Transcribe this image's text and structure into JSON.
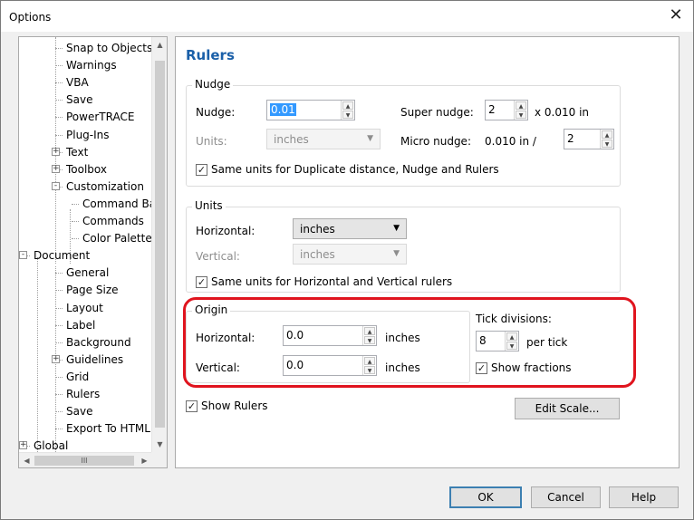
{
  "window": {
    "title": "Options",
    "close_glyph": "✕"
  },
  "tree": {
    "items": [
      {
        "label": "Snap to Objects",
        "level": 2
      },
      {
        "label": "Warnings",
        "level": 2
      },
      {
        "label": "VBA",
        "level": 2
      },
      {
        "label": "Save",
        "level": 2
      },
      {
        "label": "PowerTRACE",
        "level": 2
      },
      {
        "label": "Plug-Ins",
        "level": 2
      },
      {
        "label": "Text",
        "level": 2,
        "expander": "+"
      },
      {
        "label": "Toolbox",
        "level": 2,
        "expander": "+"
      },
      {
        "label": "Customization",
        "level": 2,
        "expander": "-"
      },
      {
        "label": "Command Ba",
        "level": 3
      },
      {
        "label": "Commands",
        "level": 3
      },
      {
        "label": "Color Palette",
        "level": 3
      },
      {
        "label": "Document",
        "level": 1,
        "expander": "-"
      },
      {
        "label": "General",
        "level": 2
      },
      {
        "label": "Page Size",
        "level": 2
      },
      {
        "label": "Layout",
        "level": 2
      },
      {
        "label": "Label",
        "level": 2
      },
      {
        "label": "Background",
        "level": 2
      },
      {
        "label": "Guidelines",
        "level": 2,
        "expander": "+"
      },
      {
        "label": "Grid",
        "level": 2
      },
      {
        "label": "Rulers",
        "level": 2,
        "selected": true
      },
      {
        "label": "Save",
        "level": 2
      },
      {
        "label": "Export To HTML",
        "level": 2
      },
      {
        "label": "Global",
        "level": 1,
        "expander": "+"
      }
    ],
    "hscroll_glyph": "III"
  },
  "panel": {
    "title": "Rulers",
    "nudge": {
      "group_title": "Nudge",
      "nudge_label": "Nudge:",
      "nudge_value": "0.01",
      "super_nudge_label": "Super nudge:",
      "super_nudge_value": "2",
      "super_nudge_suffix": "x 0.010 in",
      "units_label": "Units:",
      "units_value": "inches",
      "micro_nudge_label": "Micro nudge:",
      "micro_nudge_prefix": "0.010 in /",
      "micro_nudge_value": "2",
      "same_units_label": "Same units for Duplicate distance, Nudge and Rulers",
      "same_units_checked": true
    },
    "units": {
      "group_title": "Units",
      "horizontal_label": "Horizontal:",
      "horizontal_value": "inches",
      "vertical_label": "Vertical:",
      "vertical_value": "inches",
      "same_units_label": "Same units for Horizontal and Vertical rulers",
      "same_units_checked": true
    },
    "origin": {
      "group_title": "Origin",
      "horizontal_label": "Horizontal:",
      "horizontal_value": "0.0",
      "horizontal_unit": "inches",
      "vertical_label": "Vertical:",
      "vertical_value": "0.0",
      "vertical_unit": "inches"
    },
    "tick": {
      "title": "Tick divisions:",
      "value": "8",
      "suffix": "per tick",
      "show_fractions_label": "Show fractions",
      "show_fractions_checked": true
    },
    "show_rulers_label": "Show Rulers",
    "show_rulers_checked": true,
    "edit_scale_label": "Edit Scale..."
  },
  "footer": {
    "ok_label": "OK",
    "cancel_label": "Cancel",
    "help_label": "Help"
  },
  "colors": {
    "title_blue": "#1a5fa8",
    "highlight_red": "#e0141e",
    "selection_blue": "#3399ff"
  },
  "glyphs": {
    "check": "✓",
    "up": "▲",
    "down": "▼",
    "combo": "▼"
  }
}
